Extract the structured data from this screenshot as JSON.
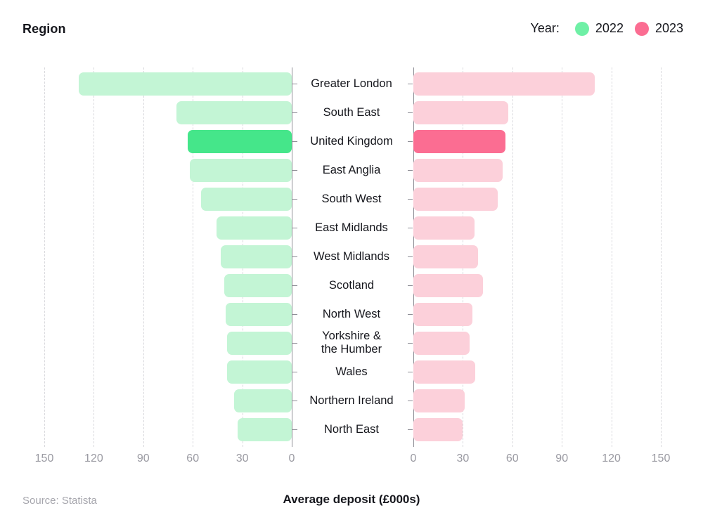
{
  "header": {
    "title": "Region",
    "legend_label": "Year:"
  },
  "legend": {
    "items": [
      {
        "label": "2022",
        "color": "#6ff0a6"
      },
      {
        "label": "2023",
        "color": "#fb6d92"
      }
    ]
  },
  "footer": {
    "source": "Source: Statista",
    "axis_title": "Average deposit (£000s)"
  },
  "axis": {
    "left_ticks": [
      "150",
      "120",
      "90",
      "60",
      "30",
      "0"
    ],
    "right_ticks": [
      "0",
      "30",
      "60",
      "90",
      "120",
      "150"
    ]
  },
  "colors": {
    "left_bar": "#c3f5d5",
    "left_bar_highlight": "#45e68a",
    "right_bar": "#fcd0da",
    "right_bar_highlight": "#fb6d92",
    "grid": "#d9d9dd",
    "axis": "#8d8d95",
    "text": "#15161c",
    "muted": "#9a9aa2"
  },
  "chart_data": {
    "type": "bar",
    "title": "Region",
    "xlabel": "Average deposit (£000s)",
    "ylabel": "Region",
    "orientation": "horizontal-diverging",
    "xlim": [
      0,
      150
    ],
    "xticks": [
      0,
      30,
      60,
      90,
      120,
      150
    ],
    "grid": true,
    "legend_position": "top-right",
    "highlight_category": "United Kingdom",
    "categories": [
      "Greater London",
      "South East",
      "United Kingdom",
      "East Anglia",
      "South West",
      "East Midlands",
      "West Midlands",
      "Scotland",
      "North West",
      "Yorkshire & the Humber",
      "Wales",
      "Northern Ireland",
      "North East"
    ],
    "series": [
      {
        "name": "2022",
        "side": "left",
        "color": "#c3f5d5",
        "highlight_color": "#45e68a",
        "values": [
          129,
          70,
          63,
          62,
          55,
          45.5,
          43,
          41,
          40,
          39,
          39,
          35,
          33
        ]
      },
      {
        "name": "2023",
        "side": "right",
        "color": "#fcd0da",
        "highlight_color": "#fb6d92",
        "values": [
          110,
          57.5,
          56,
          54,
          51,
          37,
          39,
          42,
          36,
          34,
          37.5,
          31,
          30
        ]
      }
    ]
  }
}
